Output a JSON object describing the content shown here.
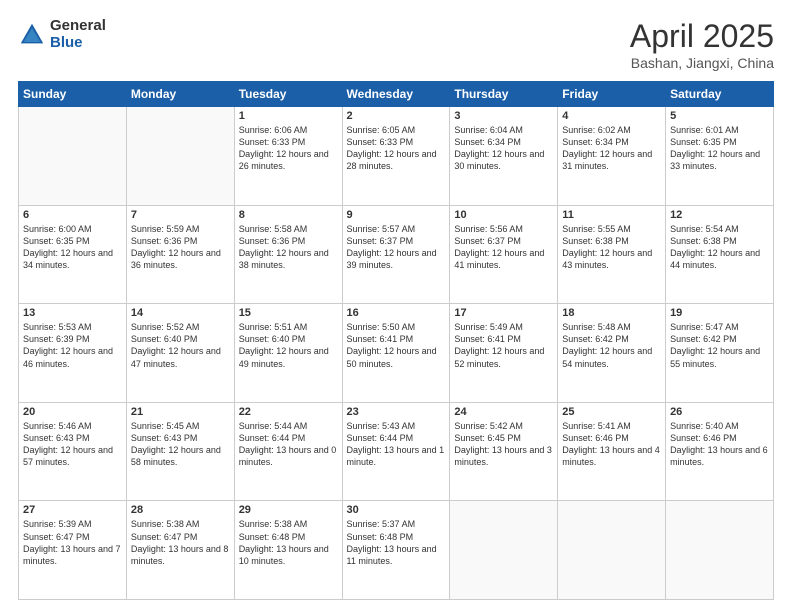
{
  "logo": {
    "general": "General",
    "blue": "Blue"
  },
  "title": "April 2025",
  "subtitle": "Bashan, Jiangxi, China",
  "headers": [
    "Sunday",
    "Monday",
    "Tuesday",
    "Wednesday",
    "Thursday",
    "Friday",
    "Saturday"
  ],
  "weeks": [
    [
      {
        "num": "",
        "info": ""
      },
      {
        "num": "",
        "info": ""
      },
      {
        "num": "1",
        "info": "Sunrise: 6:06 AM\nSunset: 6:33 PM\nDaylight: 12 hours and 26 minutes."
      },
      {
        "num": "2",
        "info": "Sunrise: 6:05 AM\nSunset: 6:33 PM\nDaylight: 12 hours and 28 minutes."
      },
      {
        "num": "3",
        "info": "Sunrise: 6:04 AM\nSunset: 6:34 PM\nDaylight: 12 hours and 30 minutes."
      },
      {
        "num": "4",
        "info": "Sunrise: 6:02 AM\nSunset: 6:34 PM\nDaylight: 12 hours and 31 minutes."
      },
      {
        "num": "5",
        "info": "Sunrise: 6:01 AM\nSunset: 6:35 PM\nDaylight: 12 hours and 33 minutes."
      }
    ],
    [
      {
        "num": "6",
        "info": "Sunrise: 6:00 AM\nSunset: 6:35 PM\nDaylight: 12 hours and 34 minutes."
      },
      {
        "num": "7",
        "info": "Sunrise: 5:59 AM\nSunset: 6:36 PM\nDaylight: 12 hours and 36 minutes."
      },
      {
        "num": "8",
        "info": "Sunrise: 5:58 AM\nSunset: 6:36 PM\nDaylight: 12 hours and 38 minutes."
      },
      {
        "num": "9",
        "info": "Sunrise: 5:57 AM\nSunset: 6:37 PM\nDaylight: 12 hours and 39 minutes."
      },
      {
        "num": "10",
        "info": "Sunrise: 5:56 AM\nSunset: 6:37 PM\nDaylight: 12 hours and 41 minutes."
      },
      {
        "num": "11",
        "info": "Sunrise: 5:55 AM\nSunset: 6:38 PM\nDaylight: 12 hours and 43 minutes."
      },
      {
        "num": "12",
        "info": "Sunrise: 5:54 AM\nSunset: 6:38 PM\nDaylight: 12 hours and 44 minutes."
      }
    ],
    [
      {
        "num": "13",
        "info": "Sunrise: 5:53 AM\nSunset: 6:39 PM\nDaylight: 12 hours and 46 minutes."
      },
      {
        "num": "14",
        "info": "Sunrise: 5:52 AM\nSunset: 6:40 PM\nDaylight: 12 hours and 47 minutes."
      },
      {
        "num": "15",
        "info": "Sunrise: 5:51 AM\nSunset: 6:40 PM\nDaylight: 12 hours and 49 minutes."
      },
      {
        "num": "16",
        "info": "Sunrise: 5:50 AM\nSunset: 6:41 PM\nDaylight: 12 hours and 50 minutes."
      },
      {
        "num": "17",
        "info": "Sunrise: 5:49 AM\nSunset: 6:41 PM\nDaylight: 12 hours and 52 minutes."
      },
      {
        "num": "18",
        "info": "Sunrise: 5:48 AM\nSunset: 6:42 PM\nDaylight: 12 hours and 54 minutes."
      },
      {
        "num": "19",
        "info": "Sunrise: 5:47 AM\nSunset: 6:42 PM\nDaylight: 12 hours and 55 minutes."
      }
    ],
    [
      {
        "num": "20",
        "info": "Sunrise: 5:46 AM\nSunset: 6:43 PM\nDaylight: 12 hours and 57 minutes."
      },
      {
        "num": "21",
        "info": "Sunrise: 5:45 AM\nSunset: 6:43 PM\nDaylight: 12 hours and 58 minutes."
      },
      {
        "num": "22",
        "info": "Sunrise: 5:44 AM\nSunset: 6:44 PM\nDaylight: 13 hours and 0 minutes."
      },
      {
        "num": "23",
        "info": "Sunrise: 5:43 AM\nSunset: 6:44 PM\nDaylight: 13 hours and 1 minute."
      },
      {
        "num": "24",
        "info": "Sunrise: 5:42 AM\nSunset: 6:45 PM\nDaylight: 13 hours and 3 minutes."
      },
      {
        "num": "25",
        "info": "Sunrise: 5:41 AM\nSunset: 6:46 PM\nDaylight: 13 hours and 4 minutes."
      },
      {
        "num": "26",
        "info": "Sunrise: 5:40 AM\nSunset: 6:46 PM\nDaylight: 13 hours and 6 minutes."
      }
    ],
    [
      {
        "num": "27",
        "info": "Sunrise: 5:39 AM\nSunset: 6:47 PM\nDaylight: 13 hours and 7 minutes."
      },
      {
        "num": "28",
        "info": "Sunrise: 5:38 AM\nSunset: 6:47 PM\nDaylight: 13 hours and 8 minutes."
      },
      {
        "num": "29",
        "info": "Sunrise: 5:38 AM\nSunset: 6:48 PM\nDaylight: 13 hours and 10 minutes."
      },
      {
        "num": "30",
        "info": "Sunrise: 5:37 AM\nSunset: 6:48 PM\nDaylight: 13 hours and 11 minutes."
      },
      {
        "num": "",
        "info": ""
      },
      {
        "num": "",
        "info": ""
      },
      {
        "num": "",
        "info": ""
      }
    ]
  ]
}
